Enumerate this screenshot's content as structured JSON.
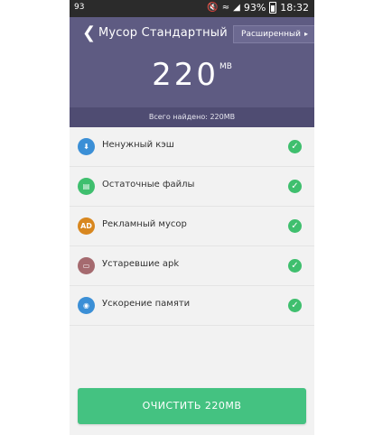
{
  "statusbar": {
    "left_text": "93",
    "battery": "93%",
    "time": "18:32"
  },
  "header": {
    "title": "Мусор Стандартный",
    "advanced_label": "Расширенный",
    "size_value": "220",
    "size_unit": "MB",
    "found_text": "Всего найдено: 220MB"
  },
  "items": [
    {
      "label": "Ненужный кэш",
      "icon": "download-icon",
      "color": "#3b8fd6"
    },
    {
      "label": "Остаточные файлы",
      "icon": "document-icon",
      "color": "#3fbf6e"
    },
    {
      "label": "Рекламный мусор",
      "icon": "AD",
      "color": "#d8871f"
    },
    {
      "label": "Устаревшие apk",
      "icon": "folder-icon",
      "color": "#a56a6f"
    },
    {
      "label": "Ускорение памяти",
      "icon": "memory-icon",
      "color": "#3b8fd6"
    }
  ],
  "clean_button": "ОЧИСТИТЬ 220MB",
  "colors": {
    "header": "#5e5b82",
    "accent_green": "#44c281"
  }
}
